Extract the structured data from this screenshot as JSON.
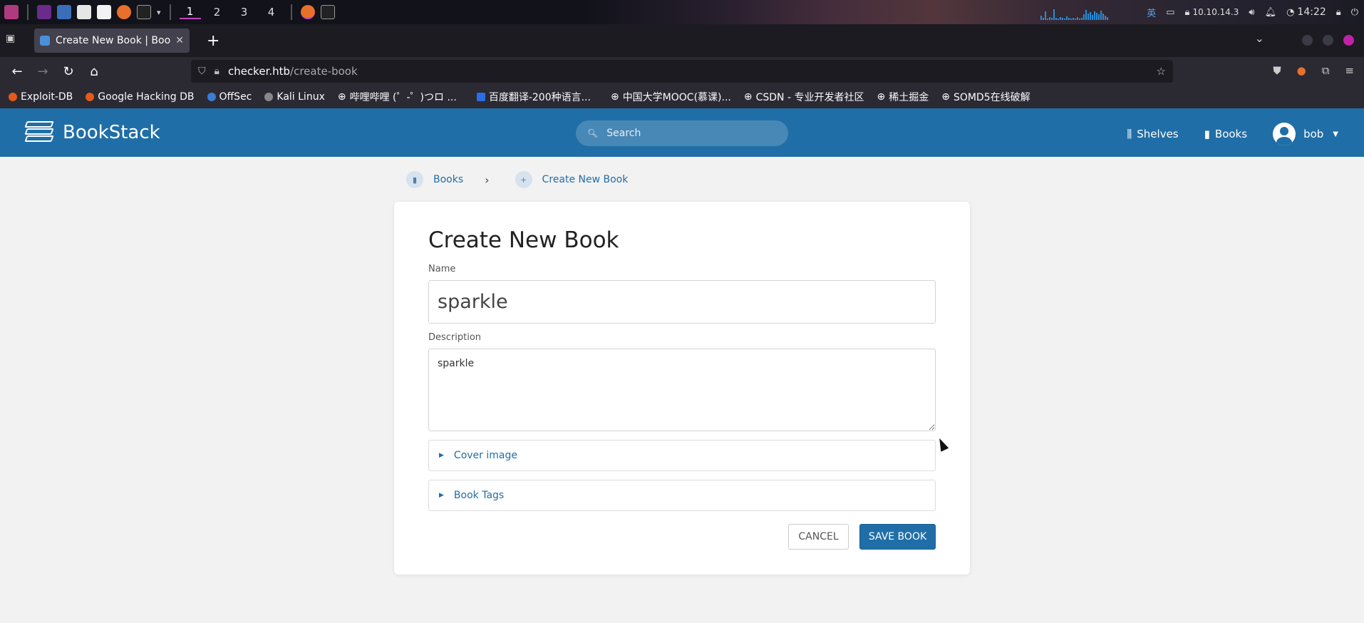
{
  "os_panel": {
    "workspaces": [
      "1",
      "2",
      "3",
      "4"
    ],
    "active_workspace": "1",
    "ime": "英",
    "ip": "10.10.14.3",
    "clock": "14:22"
  },
  "browser": {
    "tab_title": "Create New Book | BookStack",
    "url_host": "checker.htb",
    "url_path": "/create-book",
    "bookmarks": [
      "Exploit-DB",
      "Google Hacking DB",
      "OffSec",
      "Kali Linux",
      "哔哩哔哩 (゜-゜)つロ ...",
      "百度翻译-200种语言...",
      "中国大学MOOC(慕课)...",
      "CSDN - 专业开发者社区",
      "稀土掘金",
      "SOMD5在线破解"
    ]
  },
  "app": {
    "brand": "BookStack",
    "search_placeholder": "Search",
    "nav": {
      "shelves": "Shelves",
      "books": "Books",
      "user": "bob"
    }
  },
  "breadcrumb": {
    "books": "Books",
    "current": "Create New Book"
  },
  "form": {
    "title": "Create New Book",
    "name_label": "Name",
    "name_value": "sparkle",
    "description_label": "Description",
    "description_value": "sparkle",
    "cover_image": "Cover image",
    "book_tags": "Book Tags",
    "cancel": "CANCEL",
    "save": "SAVE BOOK"
  },
  "colors": {
    "brand": "#206ea7",
    "page_bg": "#f2f2f2"
  }
}
